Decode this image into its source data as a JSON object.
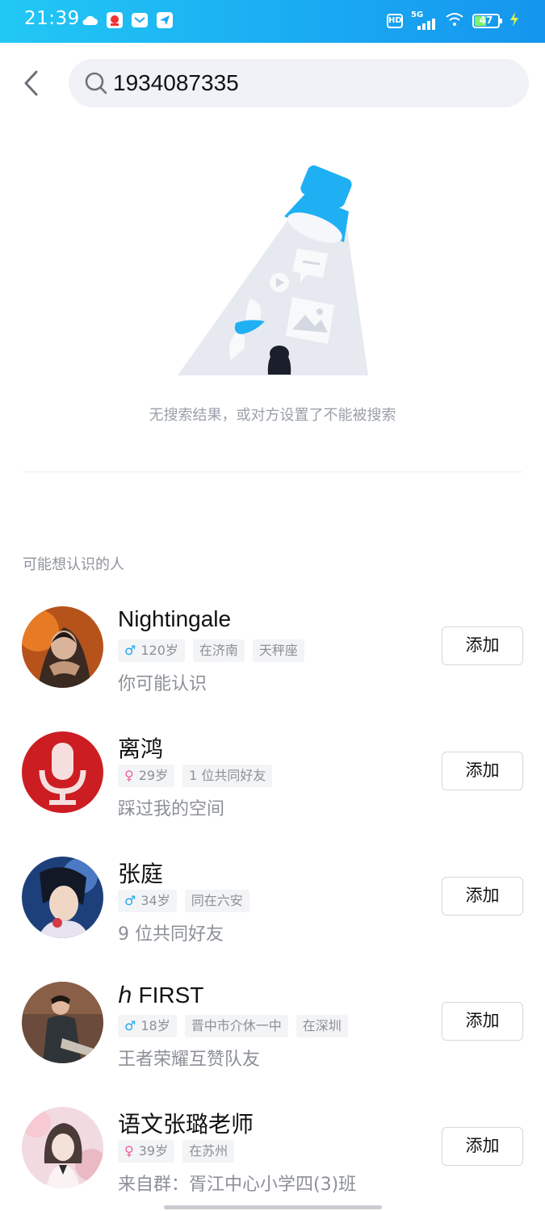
{
  "status_bar": {
    "time": "21:39",
    "battery": "47"
  },
  "search": {
    "query": "1934087335"
  },
  "empty_state": {
    "message": "无搜索结果，或对方设置了不能被搜索"
  },
  "section": {
    "title": "可能想认识的人"
  },
  "people": [
    {
      "name": "Nightingale",
      "gender": "male",
      "gender_symbol": "♂",
      "age": "120岁",
      "tags": [
        "在济南",
        "天秤座"
      ],
      "reason": "你可能认识",
      "button": "添加"
    },
    {
      "name": "离鸿",
      "gender": "female",
      "gender_symbol": "♀",
      "age": "29岁",
      "tags": [
        "1 位共同好友"
      ],
      "reason": "踩过我的空间",
      "button": "添加"
    },
    {
      "name": "张庭",
      "gender": "male",
      "gender_symbol": "♂",
      "age": "34岁",
      "tags": [
        "同在六安"
      ],
      "reason": "9 位共同好友",
      "button": "添加"
    },
    {
      "name": "ℎ FIRST",
      "gender": "male",
      "gender_symbol": "♂",
      "age": "18岁",
      "tags": [
        "晋中市介休一中",
        "在深圳"
      ],
      "reason": "王者荣耀互赞队友",
      "button": "添加"
    },
    {
      "name": "语文张璐老师",
      "gender": "female",
      "gender_symbol": "♀",
      "age": "39岁",
      "tags": [
        "在苏州"
      ],
      "reason": "来自群：胥江中心小学四(3)班",
      "button": "添加"
    }
  ],
  "colors": {
    "accent": "#1fa7f0",
    "female": "#f15fa1",
    "male": "#1fa7f0"
  }
}
